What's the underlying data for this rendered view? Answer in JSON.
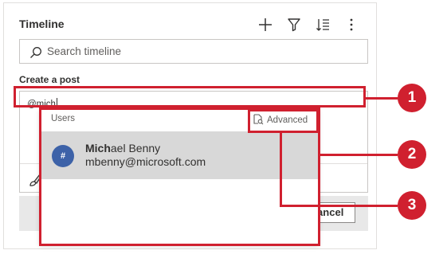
{
  "timeline": {
    "title": "Timeline",
    "toolbar": {
      "add_icon": "plus-icon",
      "filter_icon": "filter-icon",
      "sort_icon": "sort-list-icon",
      "more_icon": "more-vertical-icon"
    },
    "search": {
      "placeholder": "Search timeline",
      "icon": "search-icon"
    }
  },
  "post": {
    "caption": "Create a post",
    "input_value": "@mich",
    "format_icon": "paintbrush-icon",
    "cancel_label": "Cancel"
  },
  "mention_dropdown": {
    "section_header": "Users",
    "advanced_label": "Advanced",
    "advanced_icon": "advanced-find-icon",
    "results": [
      {
        "avatar_initial": "#",
        "name_match": "Mich",
        "name_rest": "ael Benny",
        "email": "mbenny@microsoft.com"
      }
    ]
  },
  "callouts": [
    "1",
    "2",
    "3"
  ],
  "colors": {
    "callout_red": "#d0202f",
    "avatar_blue": "#3d62a8",
    "selected_row": "#d8d8d8",
    "action_bar": "#e8e8e8"
  }
}
